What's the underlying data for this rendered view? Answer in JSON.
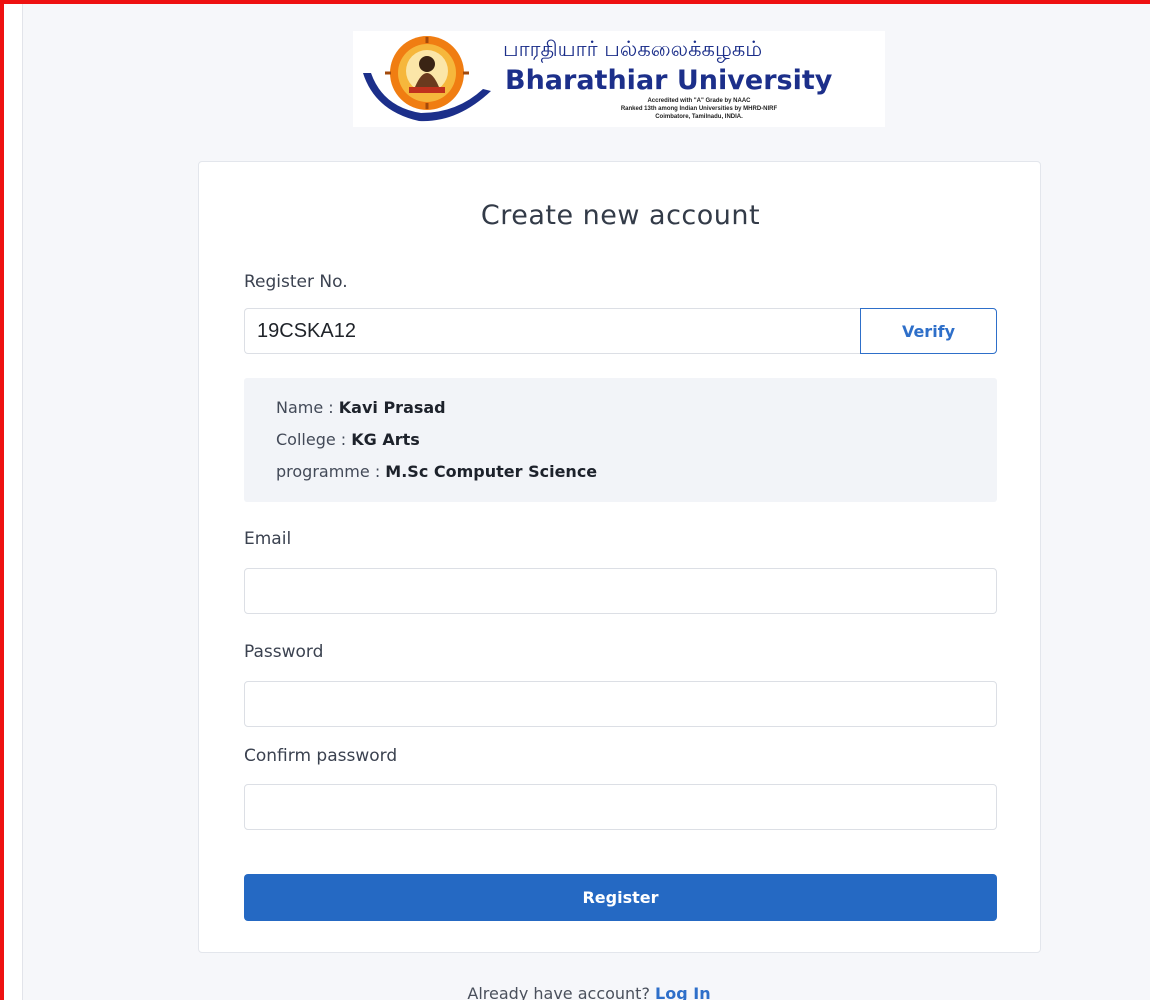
{
  "logo": {
    "tamil_name": "பாரதியார் பல்கலைக்கழகம்",
    "english_name": "Bharathiar University",
    "line1": "Accredited with \"A\" Grade by NAAC",
    "line2": "Ranked 13th among Indian Universities by MHRD-NIRF",
    "line3": "Coimbatore, Tamilnadu, INDIA."
  },
  "form": {
    "title": "Create new account",
    "register_label": "Register No.",
    "register_value": "19CSKA12",
    "verify_label": "Verify",
    "info": {
      "name_label": "Name : ",
      "name_value": "Kavi Prasad",
      "college_label": "College : ",
      "college_value": "KG Arts",
      "programme_label": "programme : ",
      "programme_value": "M.Sc Computer Science"
    },
    "email_label": "Email",
    "password_label": "Password",
    "confirm_label": "Confirm password",
    "submit_label": "Register"
  },
  "footer": {
    "text": "Already have account? ",
    "link": "Log In"
  },
  "colors": {
    "accent": "#2569c3",
    "frame_border": "#ee1111",
    "brand_blue": "#1c2f8a"
  },
  "icons": [
    "university-emblem-icon"
  ]
}
